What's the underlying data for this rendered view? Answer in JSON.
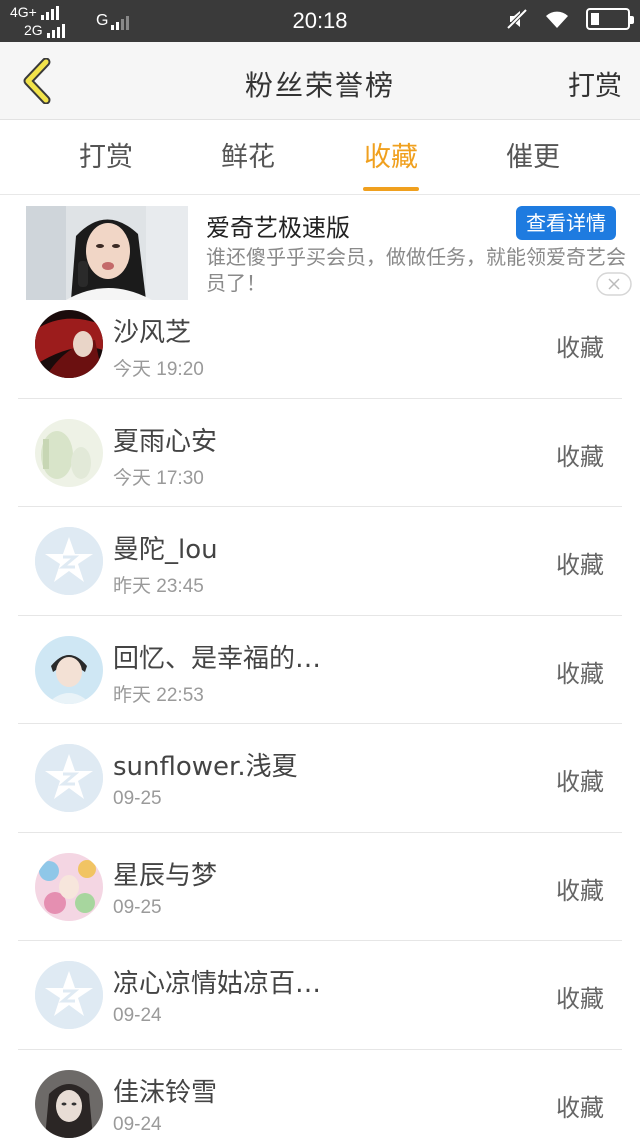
{
  "status_bar": {
    "network_top": "4G+",
    "network_bottom": "2G",
    "network_g": "G",
    "time": "20:18"
  },
  "header": {
    "title": "粉丝荣誉榜",
    "action": "打赏"
  },
  "tabs": [
    {
      "label": "打赏",
      "active": false
    },
    {
      "label": "鲜花",
      "active": false
    },
    {
      "label": "收藏",
      "active": true
    },
    {
      "label": "催更",
      "active": false
    }
  ],
  "ad": {
    "title": "爱奇艺极速版",
    "button": "查看详情",
    "description": "谁还傻乎乎买会员，做做任务，就能领爱奇艺会员了！"
  },
  "list": [
    {
      "name": "沙风芝",
      "time": "今天 19:20",
      "action": "收藏",
      "avatar": "avatar-red-hair"
    },
    {
      "name": "夏雨心安",
      "time": "今天 17:30",
      "action": "收藏",
      "avatar": "avatar-pale-green"
    },
    {
      "name": "曼陀_lou",
      "time": "昨天 23:45",
      "action": "收藏",
      "avatar": "default-avatar-icon"
    },
    {
      "name": "回忆、是幸福的…",
      "time": "昨天 22:53",
      "action": "收藏",
      "avatar": "avatar-person-blue"
    },
    {
      "name": "sunflower.浅夏",
      "time": "09-25",
      "action": "收藏",
      "avatar": "default-avatar-icon"
    },
    {
      "name": "星辰与梦",
      "time": "09-25",
      "action": "收藏",
      "avatar": "avatar-colorful-anime"
    },
    {
      "name": "凉心凉情姑凉百…",
      "time": "09-24",
      "action": "收藏",
      "avatar": "default-avatar-icon"
    },
    {
      "name": "佳沫铃雪",
      "time": "09-24",
      "action": "收藏",
      "avatar": "avatar-dark-anime"
    }
  ],
  "colors": {
    "accent": "#f0a01e",
    "ad_button": "#1e7be0",
    "status_bar": "#3a3a3a"
  }
}
